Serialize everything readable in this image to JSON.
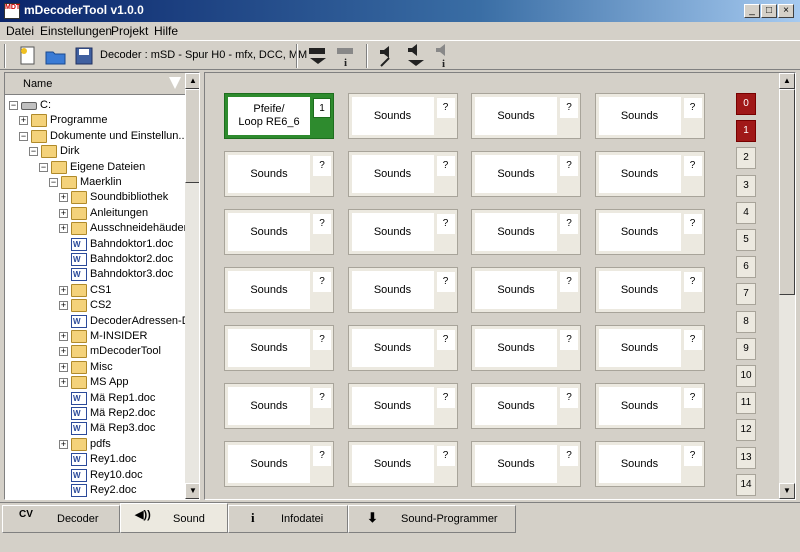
{
  "window": {
    "title": "mDecoderTool v1.0.0",
    "icon_text": "MDT"
  },
  "menu": [
    "Datei",
    "Einstellungen",
    "Projekt",
    "Hilfe"
  ],
  "toolbar": {
    "decoder_label": "Decoder : mSD - Spur H0 - mfx, DCC, MM"
  },
  "tree": {
    "header": "Name",
    "items": [
      {
        "label": "C:",
        "type": "drive",
        "level": 0,
        "toggle": "−"
      },
      {
        "label": "Programme",
        "type": "folder",
        "level": 1,
        "toggle": "+"
      },
      {
        "label": "Dokumente und Einstellun...",
        "type": "folder",
        "level": 1,
        "toggle": "−"
      },
      {
        "label": "Dirk",
        "type": "folder",
        "level": 2,
        "toggle": "−"
      },
      {
        "label": "Eigene Dateien",
        "type": "folder",
        "level": 3,
        "toggle": "−"
      },
      {
        "label": "Maerklin",
        "type": "folder",
        "level": 4,
        "toggle": "−"
      },
      {
        "label": "Soundbibliothek",
        "type": "folder",
        "level": 5,
        "toggle": "+"
      },
      {
        "label": "Anleitungen",
        "type": "folder",
        "level": 5,
        "toggle": "+"
      },
      {
        "label": "Ausschneidehäuder",
        "type": "folder",
        "level": 5,
        "toggle": "+"
      },
      {
        "label": "Bahndoktor1.doc",
        "type": "doc",
        "level": 5,
        "toggle": ""
      },
      {
        "label": "Bahndoktor2.doc",
        "type": "doc",
        "level": 5,
        "toggle": ""
      },
      {
        "label": "Bahndoktor3.doc",
        "type": "doc",
        "level": 5,
        "toggle": ""
      },
      {
        "label": "CS1",
        "type": "folder",
        "level": 5,
        "toggle": "+"
      },
      {
        "label": "CS2",
        "type": "folder",
        "level": 5,
        "toggle": "+"
      },
      {
        "label": "DecoderAdressen-DI...",
        "type": "doc",
        "level": 5,
        "toggle": ""
      },
      {
        "label": "M-INSIDER",
        "type": "folder",
        "level": 5,
        "toggle": "+"
      },
      {
        "label": "mDecoderTool",
        "type": "folder",
        "level": 5,
        "toggle": "+"
      },
      {
        "label": "Misc",
        "type": "folder",
        "level": 5,
        "toggle": "+"
      },
      {
        "label": "MS App",
        "type": "folder",
        "level": 5,
        "toggle": "+"
      },
      {
        "label": "Mä Rep1.doc",
        "type": "doc",
        "level": 5,
        "toggle": ""
      },
      {
        "label": "Mä Rep2.doc",
        "type": "doc",
        "level": 5,
        "toggle": ""
      },
      {
        "label": "Mä Rep3.doc",
        "type": "doc",
        "level": 5,
        "toggle": ""
      },
      {
        "label": "pdfs",
        "type": "folder",
        "level": 5,
        "toggle": "+"
      },
      {
        "label": "Rey1.doc",
        "type": "doc",
        "level": 5,
        "toggle": ""
      },
      {
        "label": "Rey10.doc",
        "type": "doc",
        "level": 5,
        "toggle": ""
      },
      {
        "label": "Rey2.doc",
        "type": "doc",
        "level": 5,
        "toggle": ""
      }
    ]
  },
  "sound_grid": {
    "first_slot": {
      "label": "Pfeife/\nLoop RE6_6",
      "number": "1"
    },
    "default_label": "Sounds",
    "default_number": "?",
    "rows": 7,
    "cols": 4
  },
  "pages": {
    "numbers": [
      "0",
      "1",
      "2",
      "3",
      "4",
      "5",
      "6",
      "7",
      "8",
      "9",
      "10",
      "11",
      "12",
      "13",
      "14"
    ],
    "highlighted": [
      "0",
      "1"
    ]
  },
  "tabs": [
    {
      "label": "Decoder",
      "icon": "CV",
      "icon_name": "cv-icon"
    },
    {
      "label": "Sound",
      "icon": "◀))",
      "icon_name": "speaker-icon",
      "active": true
    },
    {
      "label": "Infodatei",
      "icon": "i",
      "icon_name": "info-icon"
    },
    {
      "label": "Sound-Programmer",
      "icon": "⬇",
      "icon_name": "download-icon"
    }
  ],
  "colors": {
    "active_slot": "#2e8b2e",
    "selected_page": "#a01818",
    "title_bar": "#0a246a"
  }
}
